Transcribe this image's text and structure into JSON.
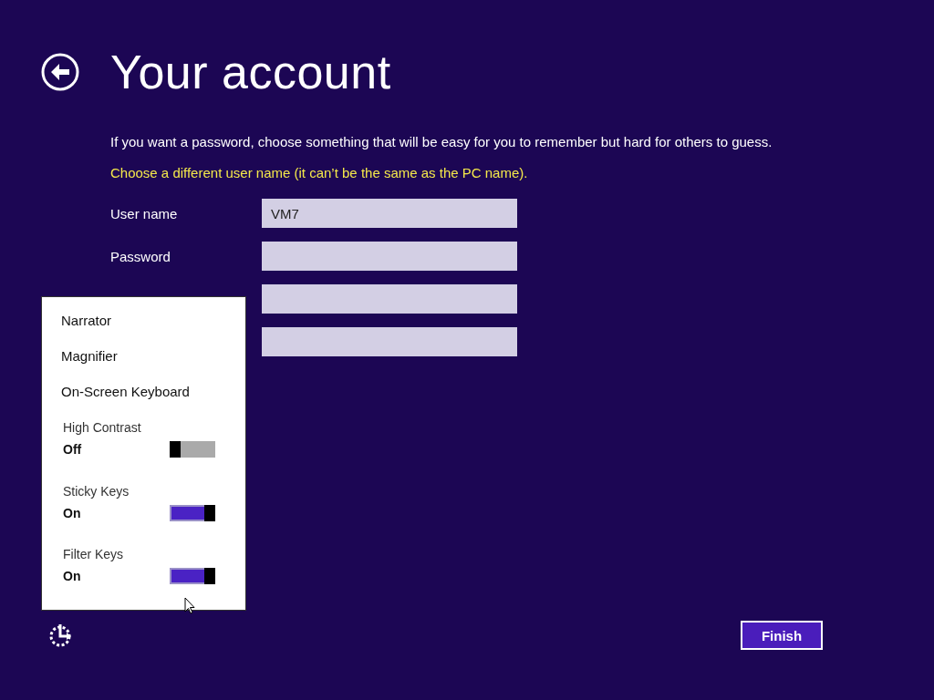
{
  "title": "Your account",
  "intro": "If you want a password, choose something that will be easy for you to remember but hard for others to guess.",
  "warning": "Choose a different user name (it can’t be the same as the PC name).",
  "fields": [
    {
      "kind": "text",
      "label": "User name",
      "value": "VM7"
    },
    {
      "kind": "password",
      "label": "Password"
    },
    {
      "kind": "password"
    },
    {
      "kind": "text"
    }
  ],
  "accessibility_menu": {
    "items": [
      {
        "kind": "link",
        "label": "Narrator"
      },
      {
        "kind": "link",
        "label": "Magnifier"
      },
      {
        "kind": "link",
        "label": "On-Screen Keyboard"
      },
      {
        "kind": "toggle",
        "label": "High Contrast",
        "state": "Off",
        "on": false
      },
      {
        "kind": "toggle",
        "label": "Sticky Keys",
        "state": "On",
        "on": true
      },
      {
        "kind": "toggle",
        "label": "Filter Keys",
        "state": "On",
        "on": true
      }
    ]
  },
  "finish_button": "Finish"
}
